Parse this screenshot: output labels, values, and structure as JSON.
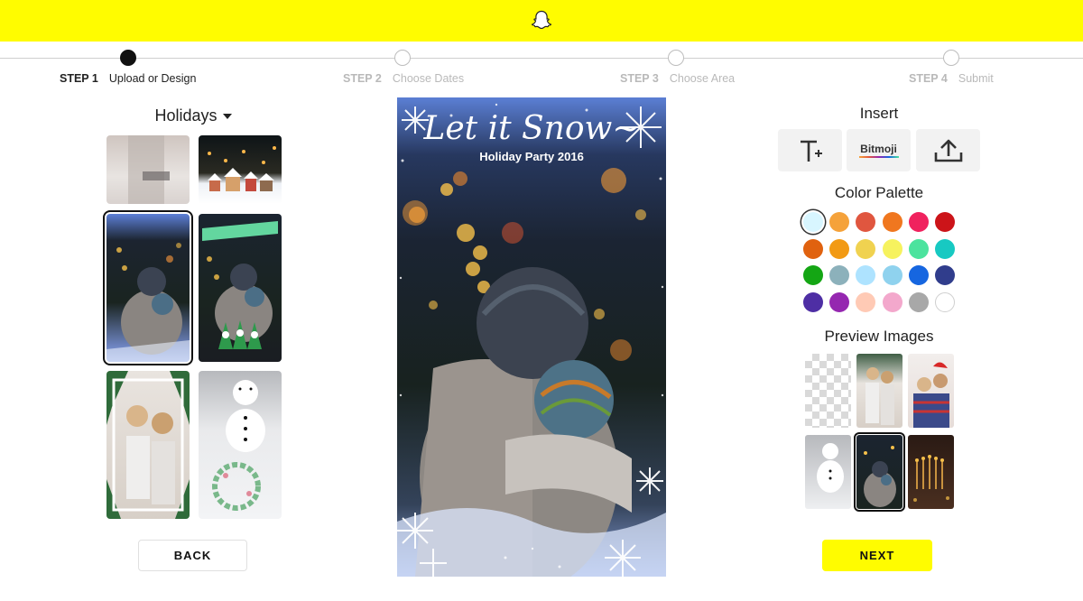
{
  "steps": [
    {
      "num": "STEP 1",
      "label": "Upload or Design",
      "active": true
    },
    {
      "num": "STEP 2",
      "label": "Choose Dates",
      "active": false
    },
    {
      "num": "STEP 3",
      "label": "Choose Area",
      "active": false
    },
    {
      "num": "STEP 4",
      "label": "Submit",
      "active": false
    }
  ],
  "category": {
    "label": "Holidays"
  },
  "preview": {
    "title": "Let it Snow~",
    "subtitle": "Holiday Party 2016"
  },
  "insert": {
    "heading": "Insert",
    "bitmoji_label": "Bitmoji"
  },
  "palette": {
    "heading": "Color Palette",
    "colors": [
      "#d8f6ff",
      "#f5a23a",
      "#e0563f",
      "#f0771f",
      "#f0225e",
      "#cc1419",
      "#e0620f",
      "#f29a14",
      "#f0d250",
      "#f6f25e",
      "#4ce39e",
      "#17c9c2",
      "#14a614",
      "#8cb1bb",
      "#aee3ff",
      "#8fd2ee",
      "#1666e0",
      "#303d8c",
      "#4e2ea4",
      "#9527b0",
      "#ffcab5",
      "#f3a8cc",
      "#a8a8a8",
      "#ffffff"
    ],
    "selected": 0
  },
  "preview_images": {
    "heading": "Preview Images"
  },
  "buttons": {
    "back": "BACK",
    "next": "NEXT"
  }
}
